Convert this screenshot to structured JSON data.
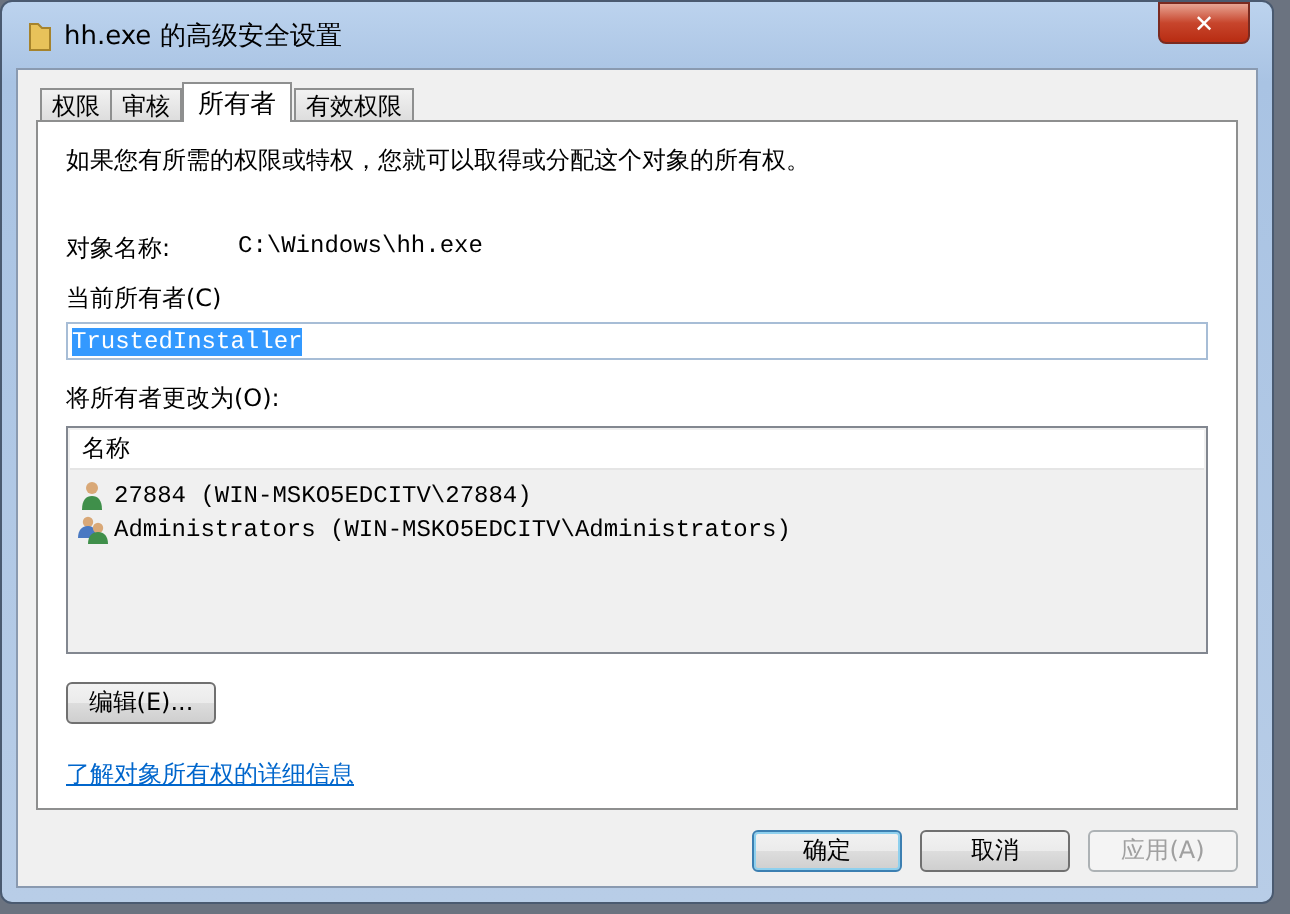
{
  "window": {
    "title": "hh.exe 的高级安全设置",
    "close": "✕"
  },
  "tabs": [
    {
      "label": "权限",
      "selected": false
    },
    {
      "label": "审核",
      "selected": false
    },
    {
      "label": "所有者",
      "selected": true
    },
    {
      "label": "有效权限",
      "selected": false
    }
  ],
  "intro": "如果您有所需的权限或特权，您就可以取得或分配这个对象的所有权。",
  "object_name": {
    "label": "对象名称:",
    "value": "C:\\Windows\\hh.exe"
  },
  "current_owner": {
    "label": "当前所有者(C)",
    "value": "TrustedInstaller",
    "selected": true
  },
  "change_to": {
    "label": "将所有者更改为(O):",
    "column": "名称",
    "rows": [
      {
        "kind": "user",
        "text": "27884 (WIN-MSKO5EDCITV\\27884)"
      },
      {
        "kind": "group",
        "text": "Administrators (WIN-MSKO5EDCITV\\Administrators)"
      }
    ]
  },
  "edit_button": "编辑(E)...",
  "link": "了解对象所有权的详细信息",
  "buttons": [
    {
      "label": "确定",
      "disabled": false,
      "default": true
    },
    {
      "label": "取消",
      "disabled": false,
      "default": false
    },
    {
      "label": "应用(A)",
      "disabled": true,
      "default": false
    }
  ]
}
